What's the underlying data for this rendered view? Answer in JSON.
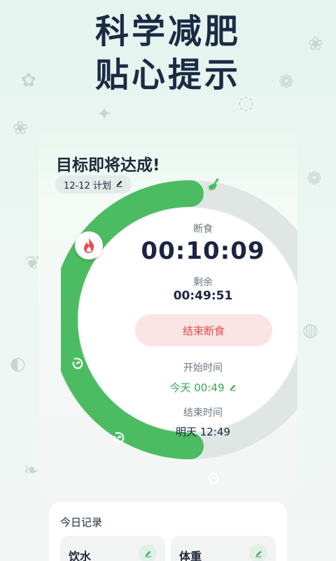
{
  "hero": {
    "line1": "科学减肥",
    "line2": "贴心提示"
  },
  "card": {
    "goal_title": "目标即将达成!",
    "plan_label": "12-12 计划",
    "fasting_label": "断食",
    "fasting_timer": "00:10:09",
    "remaining_label": "剩余",
    "remaining_timer": "00:49:51",
    "end_button": "结束断食",
    "start_label": "开始时间",
    "start_value": "今天 00:49",
    "end_label": "结束时间",
    "end_value": "明天 12:49",
    "progress_fraction": 0.5
  },
  "records": {
    "title": "今日记录",
    "water_label": "饮水",
    "weight_label": "体重"
  },
  "colors": {
    "accent": "#4cbc62",
    "danger": "#e24d4d",
    "ring_track": "#e3e8e6"
  },
  "icons": [
    "pencil-icon",
    "broom-icon",
    "fire-icon",
    "stage-icon"
  ]
}
